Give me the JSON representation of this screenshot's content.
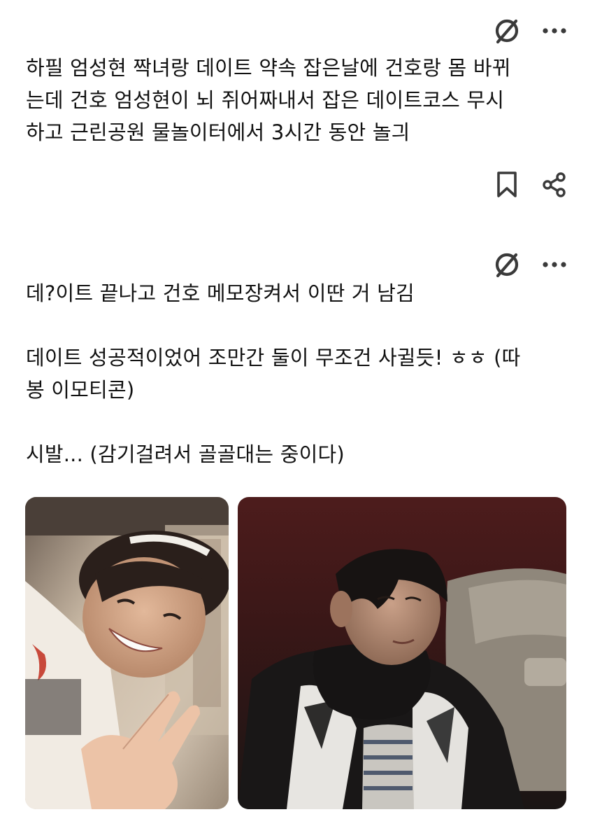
{
  "posts": [
    {
      "icons": {
        "hide": "eye-off-slash-icon",
        "more": "more-horizontal-icon",
        "bookmark": "bookmark-icon",
        "share": "share-icon"
      },
      "text_lines": [
        "하필 엄성현 짝녀랑 데이트 약속 잡은날에 건호랑 몸 바뀌",
        "는데  건호 엄성현이 뇌 쥐어짜내서 잡은 데이트코스 무시",
        "하고 근린공원 물놀이터에서 3시간 동안 놀긔"
      ]
    },
    {
      "icons": {
        "hide": "eye-off-slash-icon",
        "more": "more-horizontal-icon"
      },
      "paragraphs": [
        [
          "데?이트 끝나고 건호 메모장켜서 이딴 거 남김"
        ],
        [
          "데이트 성공적이었어 조만간 둘이 무조건 사귈듯! ㅎㅎ (따",
          "봉 이모티콘)"
        ],
        [
          "시발... (감기걸려서 골골대는 중이다)"
        ]
      ],
      "photos": [
        {
          "alt": "photo-left"
        },
        {
          "alt": "photo-right"
        }
      ]
    }
  ],
  "colors": {
    "text": "#111111",
    "icon": "#3a3a3a",
    "background": "#ffffff"
  }
}
